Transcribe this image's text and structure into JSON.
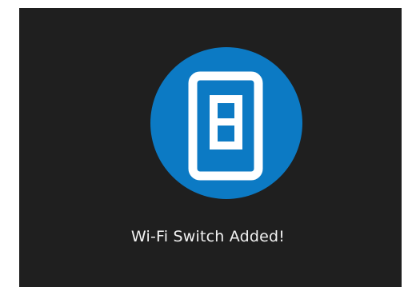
{
  "dialog": {
    "icon": "wifi-switch-icon",
    "message": "Wi-Fi Switch Added!"
  },
  "colors": {
    "background": "#1f1f1f",
    "accent": "#0c7ac4",
    "icon_stroke": "#ffffff",
    "text": "#f2f2f2"
  }
}
